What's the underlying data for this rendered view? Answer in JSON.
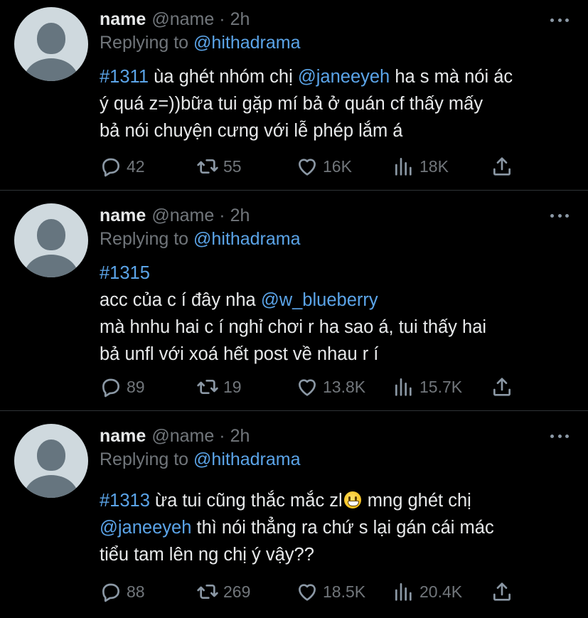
{
  "tweets": [
    {
      "name": "name",
      "handle": "@name",
      "separator": "·",
      "time": "2h",
      "replying_label": "Replying to",
      "replying_to": "@hithadrama",
      "lines": [
        [
          {
            "t": "#1311",
            "link": true
          },
          {
            "t": " ùa ghét nhóm chị "
          },
          {
            "t": "@janeeyeh",
            "link": true
          },
          {
            "t": " ha s mà nói ác"
          }
        ],
        [
          {
            "t": "ý quá z=))bữa tui gặp mí bả ở quán cf thấy mấy"
          }
        ],
        [
          {
            "t": "bả nói chuyện cưng với lễ phép lắm á"
          }
        ]
      ],
      "replies": "42",
      "retweets": "55",
      "likes": "16K",
      "views": "18K"
    },
    {
      "name": "name",
      "handle": "@name",
      "separator": "·",
      "time": "2h",
      "replying_label": "Replying to",
      "replying_to": "@hithadrama",
      "lines": [
        [
          {
            "t": "#1315",
            "link": true
          }
        ],
        [
          {
            "t": "acc của c í đây nha "
          },
          {
            "t": "@w_blueberry",
            "link": true
          }
        ],
        [
          {
            "t": "mà hnhu hai c í nghỉ chơi r ha sao á, tui thấy hai"
          }
        ],
        [
          {
            "t": "bả unfl với xoá hết post về nhau r í"
          }
        ]
      ],
      "replies": "89",
      "retweets": "19",
      "likes": "13.8K",
      "views": "15.7K"
    },
    {
      "name": "name",
      "handle": "@name",
      "separator": "·",
      "time": "2h",
      "replying_label": "Replying to",
      "replying_to": "@hithadrama",
      "lines": [
        [
          {
            "t": "#1313",
            "link": true
          },
          {
            "t": " ừa tui cũng thắc mắc zl"
          },
          {
            "emoji": "grinning-face-emoji"
          },
          {
            "t": " mng ghét chị"
          }
        ],
        [
          {
            "t": "@janeeyeh",
            "link": true
          },
          {
            "t": " thì nói thẳng ra chứ s lại gán cái mác"
          }
        ],
        [
          {
            "t": "tiểu tam lên ng chị ý vậy??"
          }
        ]
      ],
      "replies": "88",
      "retweets": "269",
      "likes": "18.5K",
      "views": "20.4K"
    }
  ],
  "icons": {
    "reply": "reply-icon",
    "retweet": "retweet-icon",
    "like": "heart-icon",
    "views": "views-icon",
    "share": "share-icon",
    "more": "more-icon"
  },
  "colors": {
    "background": "#000000",
    "text": "#e7e9ea",
    "secondary": "#71767b",
    "link": "#5ba4e8",
    "divider": "#2f3336"
  }
}
